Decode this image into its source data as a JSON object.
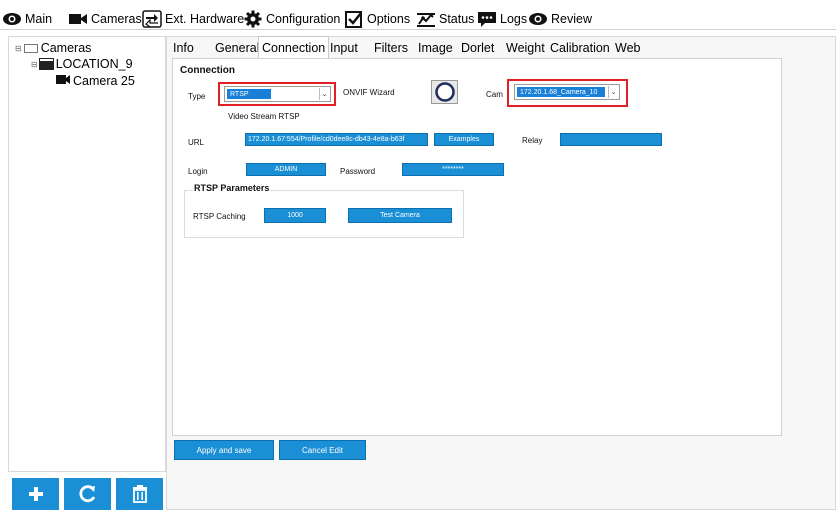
{
  "menu": [
    {
      "label": "Main",
      "icon": "eye-icon"
    },
    {
      "label": "Cameras",
      "icon": "video-camera-icon"
    },
    {
      "label": "Ext. Hardware",
      "icon": "hardware-arrows-icon"
    },
    {
      "label": "Configuration",
      "icon": "gear-icon"
    },
    {
      "label": "Options",
      "icon": "checkbox-icon"
    },
    {
      "label": "Status",
      "icon": "status-chart-icon"
    },
    {
      "label": "Logs",
      "icon": "chat-bubble-icon"
    },
    {
      "label": "Review",
      "icon": "eye-icon"
    }
  ],
  "tree": {
    "root": "Cameras",
    "location": "LOCATION_9",
    "camera": "Camera 25"
  },
  "tabs": [
    "Info",
    "General",
    "Connection",
    "Input",
    "Filters",
    "Image",
    "Dorlet",
    "Weight",
    "Calibration",
    "Web"
  ],
  "active_tab": "Connection",
  "connection": {
    "section_title": "Connection",
    "type_label": "Type",
    "type_value": "RTSP",
    "onvif_label": "ONVIF Wizard",
    "cam_label": "Cam",
    "cam_value": "172.20.1.68_Camera_10",
    "video_stream_label": "Video Stream RTSP",
    "url_label": "URL",
    "url_value": "172.20.1.67:554/Profile/cd0dee8c-db43-4e8a-b63f",
    "examples_label": "Examples",
    "relay_label": "Relay",
    "relay_value": "",
    "login_label": "Login",
    "login_value": "ADMIN",
    "password_label": "Password",
    "password_value": "********"
  },
  "rtsp": {
    "title": "RTSP Parameters",
    "caching_label": "RTSP Caching",
    "caching_value": "1000",
    "test_label": "Test Camera"
  },
  "footer": {
    "apply_label": "Apply and save",
    "cancel_label": "Cancel Edit"
  },
  "colors": {
    "accent": "#1a8fd6",
    "highlight": "#e01f26"
  }
}
